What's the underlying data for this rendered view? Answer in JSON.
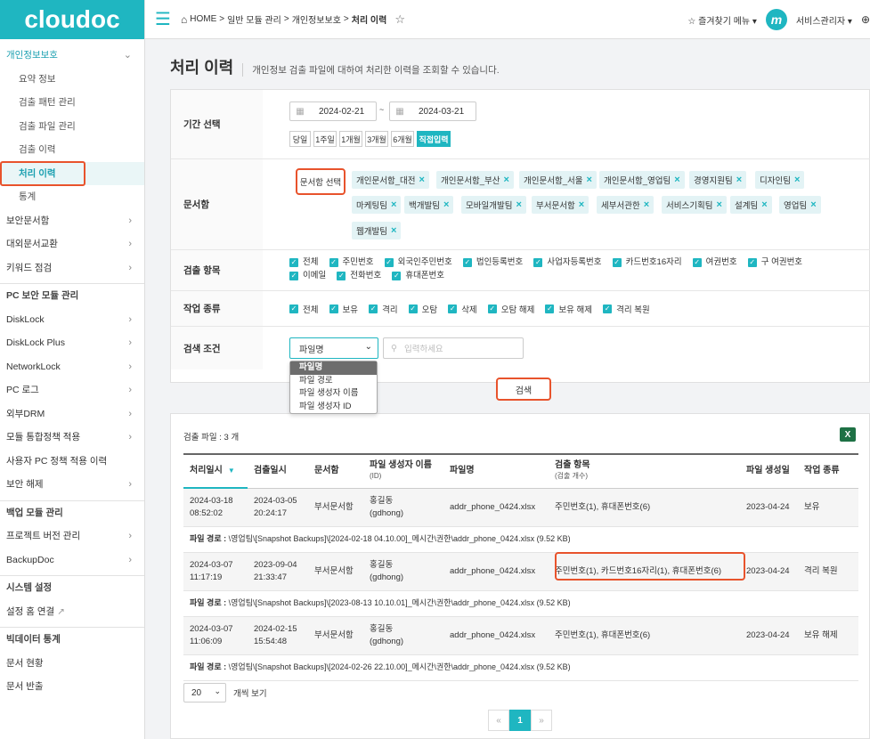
{
  "logo": "cloudoc",
  "sidebar": {
    "items": [
      {
        "label": "개인정보보호",
        "chevron": "⌄"
      },
      {
        "label": "요약 정보"
      },
      {
        "label": "검출 패턴 관리"
      },
      {
        "label": "검출 파일 관리"
      },
      {
        "label": "검출 이력"
      },
      {
        "label": "처리 이력"
      },
      {
        "label": "통계"
      },
      {
        "label": "보안문서함",
        "chevron": "›"
      },
      {
        "label": "대외문서교환",
        "chevron": "›"
      },
      {
        "label": "키워드 점검",
        "chevron": "›"
      },
      {
        "label": "PC 보안 모듈 관리"
      },
      {
        "label": "DiskLock",
        "chevron": "›"
      },
      {
        "label": "DiskLock Plus",
        "chevron": "›"
      },
      {
        "label": "NetworkLock",
        "chevron": "›"
      },
      {
        "label": "PC 로그",
        "chevron": "›"
      },
      {
        "label": "외부DRM",
        "chevron": "›"
      },
      {
        "label": "모듈 통합정책 적용",
        "chevron": "›"
      },
      {
        "label": "사용자 PC 정책 적용 이력"
      },
      {
        "label": "보안 해제",
        "chevron": "›"
      },
      {
        "label": "백업 모듈 관리"
      },
      {
        "label": "프로젝트 버전 관리",
        "chevron": "›"
      },
      {
        "label": "BackupDoc",
        "chevron": "›"
      },
      {
        "label": "시스템 설정"
      },
      {
        "label": "설정 홈 연결",
        "ext": "↗"
      },
      {
        "label": "빅데이터 통계"
      },
      {
        "label": "문서 현황"
      },
      {
        "label": "문서 반출"
      }
    ]
  },
  "topbar": {
    "breadcrumb": [
      "HOME",
      ">",
      "일반 모듈 관리",
      ">",
      "개인정보보호",
      ">",
      "처리 이력"
    ],
    "favorites": "즐겨찾기 메뉴",
    "avatar_letter": "m",
    "user": "서비스관리자"
  },
  "page": {
    "title": "처리 이력",
    "description": "개인정보 검출 파일에 대하여 처리한 이력을 조회할 수 있습니다."
  },
  "filters": {
    "period_label": "기간 선택",
    "date_from": "2024-02-21",
    "date_sep": "~",
    "date_to": "2024-03-21",
    "period_buttons": [
      "당일",
      "1주일",
      "1개월",
      "3개월",
      "6개월",
      "직접입력"
    ],
    "docbox_label": "문서함",
    "docbox_select": "문서함 선택",
    "docbox_tags": [
      "개인문서함_대전",
      "개인문서함_부산",
      "개인문서함_서울",
      "개인문서함_영업팀",
      "경영지원팀",
      "디자인팀",
      "마케팅팀",
      "백개발팀",
      "모바일개발팀",
      "부서문서함",
      "세부서관한",
      "서비스기획팀",
      "설계팀",
      "영업팀",
      "웹개발팀"
    ],
    "detect_label": "검출 항목",
    "detect_items": [
      "전체",
      "주민번호",
      "외국인주민번호",
      "법인등록번호",
      "사업자등록번호",
      "카드번호16자리",
      "여권번호",
      "구 여권번호",
      "이메일",
      "전화번호",
      "휴대폰번호"
    ],
    "work_label": "작업 종류",
    "work_items": [
      "전체",
      "보유",
      "격리",
      "오탐",
      "삭제",
      "오탐 해제",
      "보유 해제",
      "격리 복원"
    ],
    "search_label": "검색 조건",
    "search_select": "파일명",
    "search_placeholder": "입력하세요",
    "search_options": [
      "파일명",
      "파일 경로",
      "파일 생성자 이름",
      "파일 생성자 ID"
    ],
    "search_button": "검색"
  },
  "results": {
    "count": "검출 파일 : 3 개",
    "excel": "X",
    "headers": {
      "processed": "처리일시",
      "detected": "검출일시",
      "docbox": "문서함",
      "creator": "파일 생성자 이름",
      "creator_sub": "(ID)",
      "filename": "파일명",
      "detect": "검출 항목",
      "detect_sub": "(검출 개수)",
      "created": "파일 생성일",
      "work": "작업 종류"
    },
    "sort_icon": "▼",
    "path_label": "파일 경로 :",
    "rows": [
      {
        "processed_date": "2024-03-18",
        "processed_time": "08:52:02",
        "detected_date": "2024-03-05",
        "detected_time": "20:24:17",
        "docbox": "부서문서함",
        "creator": "홍길동",
        "creator_id": "(gdhong)",
        "filename": "addr_phone_0424.xlsx",
        "detect": "주민번호(1), 휴대폰번호(6)",
        "created": "2023-04-24",
        "work": "보유",
        "path": "\\영업팀\\[Snapshot Backups]\\[2024-02-18 04.10.00]_메시간\\권한\\addr_phone_0424.xlsx (9.52 KB)"
      },
      {
        "processed_date": "2024-03-07",
        "processed_time": "11:17:19",
        "detected_date": "2023-09-04",
        "detected_time": "21:33:47",
        "docbox": "부서문서함",
        "creator": "홍길동",
        "creator_id": "(gdhong)",
        "filename": "addr_phone_0424.xlsx",
        "detect": "주민번호(1), 카드번호16자리(1), 휴대폰번호(6)",
        "created": "2023-04-24",
        "work": "격리 복원",
        "path": "\\영업팀\\[Snapshot Backups]\\[2023-08-13 10.10.01]_메시간\\권한\\addr_phone_0424.xlsx (9.52 KB)"
      },
      {
        "processed_date": "2024-03-07",
        "processed_time": "11:06:09",
        "detected_date": "2024-02-15",
        "detected_time": "15:54:48",
        "docbox": "부서문서함",
        "creator": "홍길동",
        "creator_id": "(gdhong)",
        "filename": "addr_phone_0424.xlsx",
        "detect": "주민번호(1), 휴대폰번호(6)",
        "created": "2023-04-24",
        "work": "보유 해제",
        "path": "\\영업팀\\[Snapshot Backups]\\[2024-02-26 22.10.00]_메시간\\권한\\addr_phone_0424.xlsx (9.52 KB)"
      }
    ],
    "per_page": "20",
    "per_page_label": "개씩 보기",
    "pager": {
      "prev": "«",
      "current": "1",
      "next": "»"
    }
  },
  "colors": {
    "accent": "#1fb6c1",
    "highlight": "#e8532c"
  }
}
